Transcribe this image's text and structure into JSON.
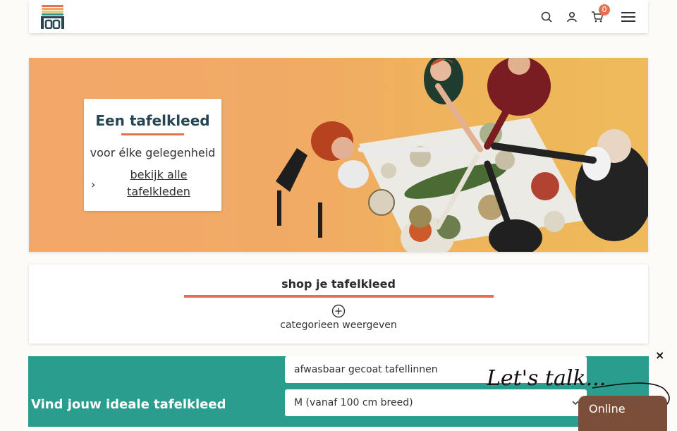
{
  "header": {
    "logo_name": "store-logo",
    "icons": [
      "search-icon",
      "account-icon",
      "cart-icon",
      "menu-icon"
    ],
    "cart_count": "0"
  },
  "hero": {
    "title": "Een tafelkleed",
    "subtitle": "voor élke gelegenheid",
    "link_label": "bekijk alle tafelkleden",
    "chevron": "›"
  },
  "shop": {
    "title": "shop je tafelkleed",
    "toggle_label": "categorieen weergeven"
  },
  "finder": {
    "title": "Vind jouw ideale tafelkleed",
    "material_value": "afwasbaar gecoat tafellinnen",
    "size_value": "M (vanaf 100 cm breed)"
  },
  "chat": {
    "close": "×",
    "script_text": "Let's talk...",
    "status": "Online"
  },
  "colors": {
    "accent": "#e76f51",
    "teal": "#2a9d8f",
    "navy": "#264653",
    "chat_brown": "#7a4e39"
  }
}
